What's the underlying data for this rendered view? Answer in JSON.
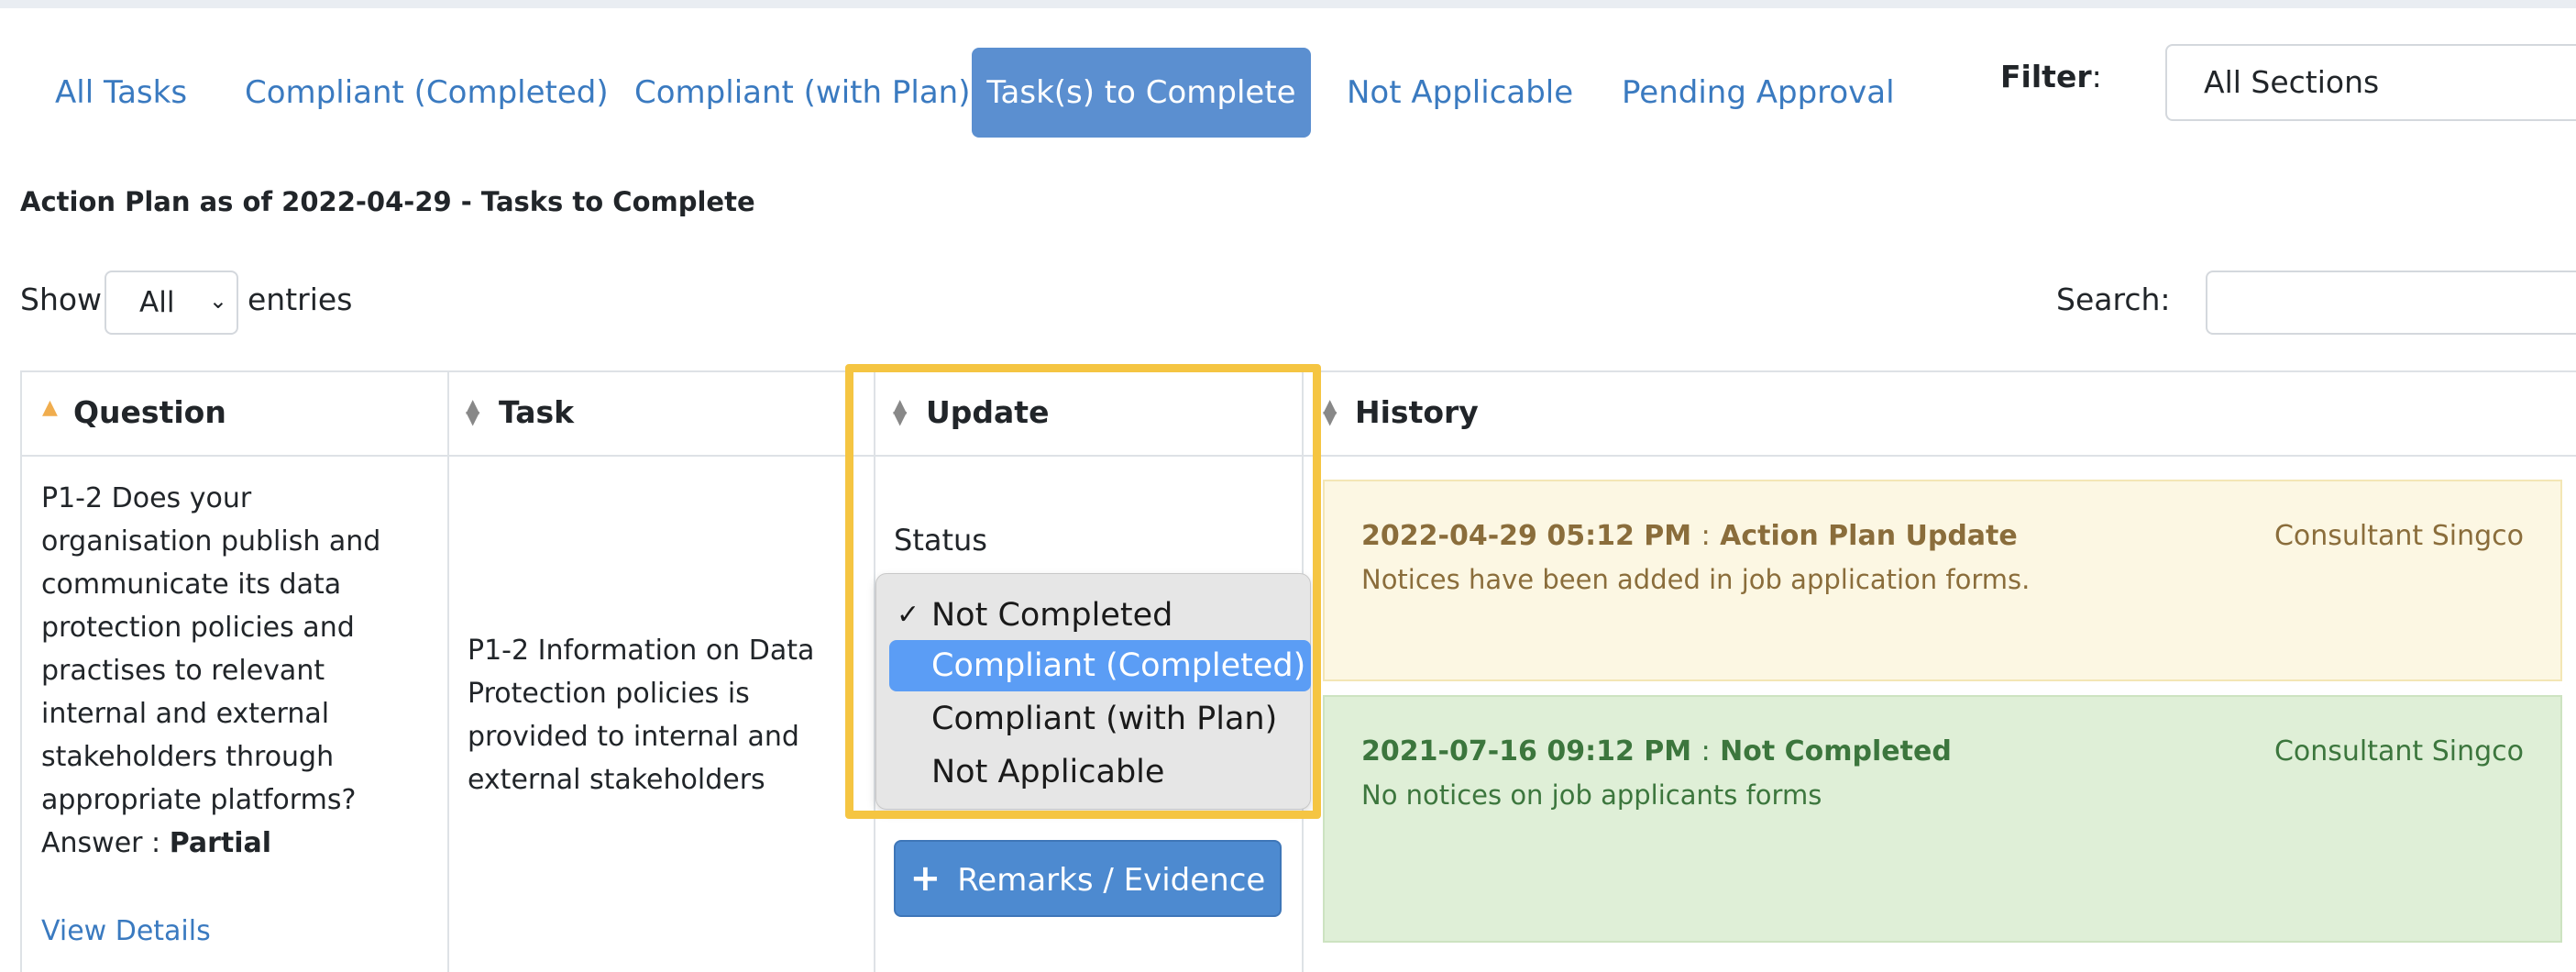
{
  "tabs": [
    {
      "label": "All Tasks"
    },
    {
      "label": "Compliant (Completed)"
    },
    {
      "label": "Compliant (with Plan)"
    },
    {
      "label": "Task(s) to Complete",
      "active": true
    },
    {
      "label": "Not Applicable"
    },
    {
      "label": "Pending Approval"
    }
  ],
  "filter": {
    "label": "Filter",
    "colon": ":",
    "value": "All Sections"
  },
  "heading": "Action Plan as of 2022-04-29 - Tasks to Complete",
  "show": {
    "label": "Show",
    "value": "All",
    "suffix": "entries"
  },
  "search": {
    "label": "Search:",
    "value": ""
  },
  "table": {
    "headers": {
      "question": "Question",
      "task": "Task",
      "update": "Update",
      "history": "History"
    },
    "row": {
      "question": "P1-2 Does your organisation publish and communicate its data protection policies and practises to relevant internal and external stakeholders through appropriate platforms?",
      "answer_label": "Answer :",
      "answer_value": "Partial",
      "view_details": "View Details",
      "task": "P1-2 Information on Data Protection policies is provided to internal and external stakeholders",
      "status_label": "Status",
      "status_options": [
        {
          "label": "Not Completed",
          "checked": true
        },
        {
          "label": "Compliant (Completed)",
          "highlighted": true
        },
        {
          "label": "Compliant (with Plan)"
        },
        {
          "label": "Not Applicable"
        }
      ],
      "remarks_button": "Remarks / Evidence",
      "history": [
        {
          "timestamp": "2022-04-29 05:12 PM",
          "sep": ":",
          "title": "Action Plan Update",
          "body": "Notices have been added in job application forms.",
          "by": "Consultant Singco",
          "color": "#8a6d3b"
        },
        {
          "timestamp": "2021-07-16 09:12 PM",
          "sep": ":",
          "title": "Not Completed",
          "body": "No notices on job applicants forms",
          "by": "Consultant Singco",
          "color": "#3c763d"
        }
      ]
    }
  },
  "colors": {
    "accent": "#5b8fd0",
    "link": "#3a7ac0",
    "highlight_box": "#f5c542"
  }
}
